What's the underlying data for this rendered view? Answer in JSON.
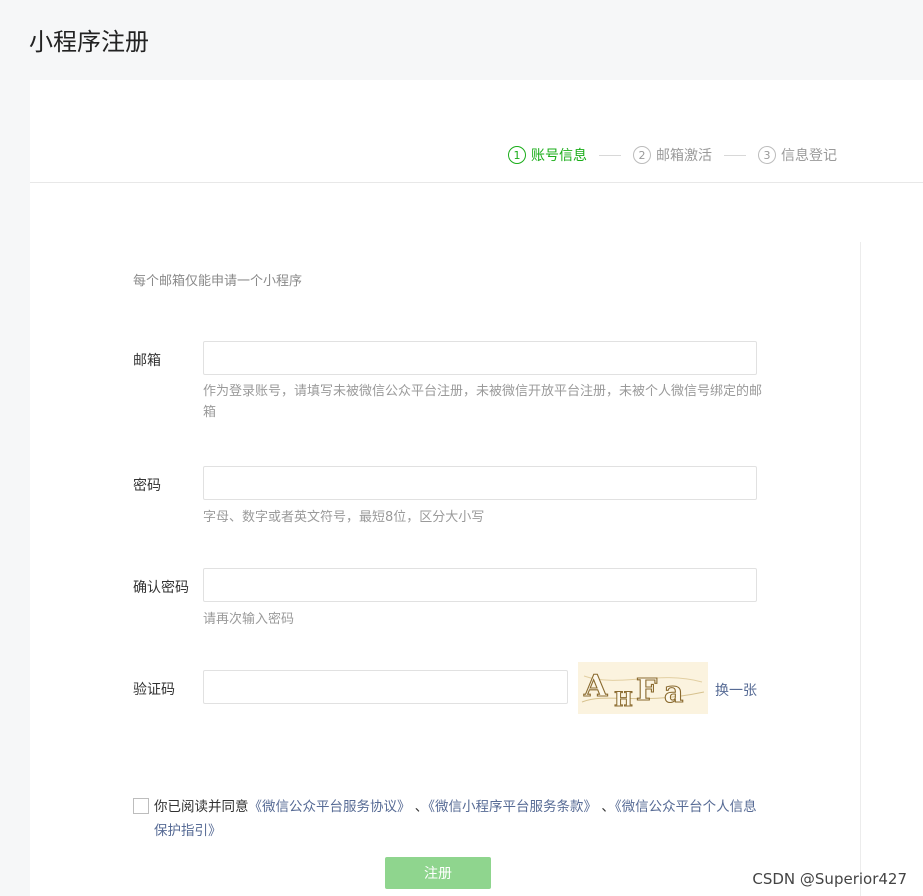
{
  "page": {
    "title": "小程序注册"
  },
  "steps": [
    {
      "num": "1",
      "label": "账号信息",
      "active": true
    },
    {
      "num": "2",
      "label": "邮箱激活",
      "active": false
    },
    {
      "num": "3",
      "label": "信息登记",
      "active": false
    }
  ],
  "form": {
    "tip": "每个邮箱仅能申请一个小程序",
    "email": {
      "label": "邮箱",
      "value": "",
      "hint": "作为登录账号，请填写未被微信公众平台注册，未被微信开放平台注册，未被个人微信号绑定的邮箱"
    },
    "password": {
      "label": "密码",
      "value": "",
      "hint": "字母、数字或者英文符号，最短8位，区分大小写"
    },
    "confirm": {
      "label": "确认密码",
      "value": "",
      "hint": "请再次输入密码"
    },
    "captcha": {
      "label": "验证码",
      "value": "",
      "image_text": "AHFa",
      "refresh_label": "换一张"
    }
  },
  "agreement": {
    "checked": false,
    "prefix": "你已阅读并同意",
    "link1": "《微信公众平台服务协议》",
    "sep1": " 、",
    "link2": "《微信小程序平台服务条款》",
    "sep2": " 、",
    "link3": "《微信公众平台个人信息保护指引》"
  },
  "register_button": "注册",
  "watermark": "CSDN @Superior427",
  "colors": {
    "accent": "#1aad19",
    "link": "#576b95",
    "button_disabled": "#8fd58e"
  }
}
